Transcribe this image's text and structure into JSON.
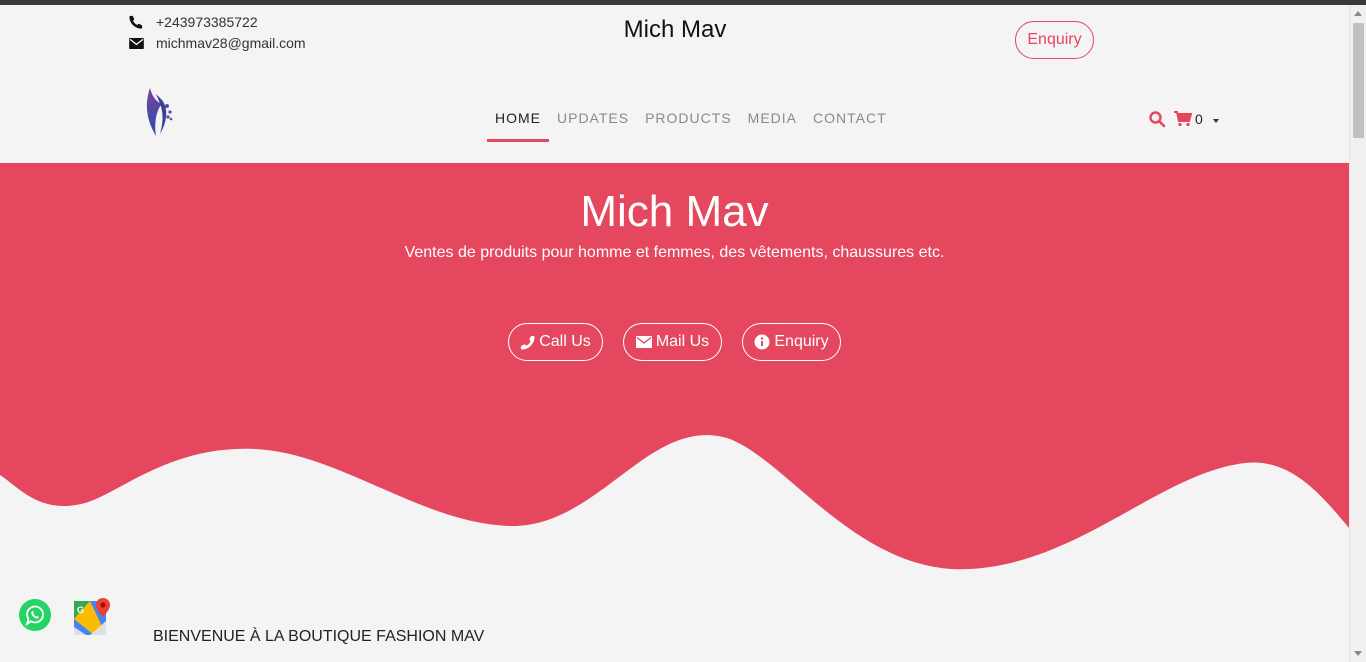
{
  "header": {
    "phone": "+243973385722",
    "email": "michmav28@gmail.com",
    "site_title": "Mich Mav",
    "enquiry_label": "Enquiry"
  },
  "nav": {
    "items": [
      {
        "label": "HOME",
        "active": true
      },
      {
        "label": "UPDATES",
        "active": false
      },
      {
        "label": "PRODUCTS",
        "active": false
      },
      {
        "label": "MEDIA",
        "active": false
      },
      {
        "label": "CONTACT",
        "active": false
      }
    ],
    "cart_count": "0"
  },
  "hero": {
    "title": "Mich Mav",
    "subtitle": "Ventes de produits pour homme et femmes, des vêtements, chaussures etc.",
    "buttons": {
      "call": "Call Us",
      "mail": "Mail Us",
      "enquiry": "Enquiry"
    }
  },
  "welcome": "BIENVENUE À LA BOUTIQUE FASHION MAV",
  "colors": {
    "accent": "#e5475f",
    "background": "#f4f4f4",
    "whatsapp": "#25d366"
  },
  "icons": {
    "phone": "phone-icon",
    "mail": "envelope-icon",
    "search": "search-icon",
    "cart": "cart-icon",
    "info": "info-icon",
    "whatsapp": "whatsapp-icon",
    "maps": "google-maps-icon"
  }
}
